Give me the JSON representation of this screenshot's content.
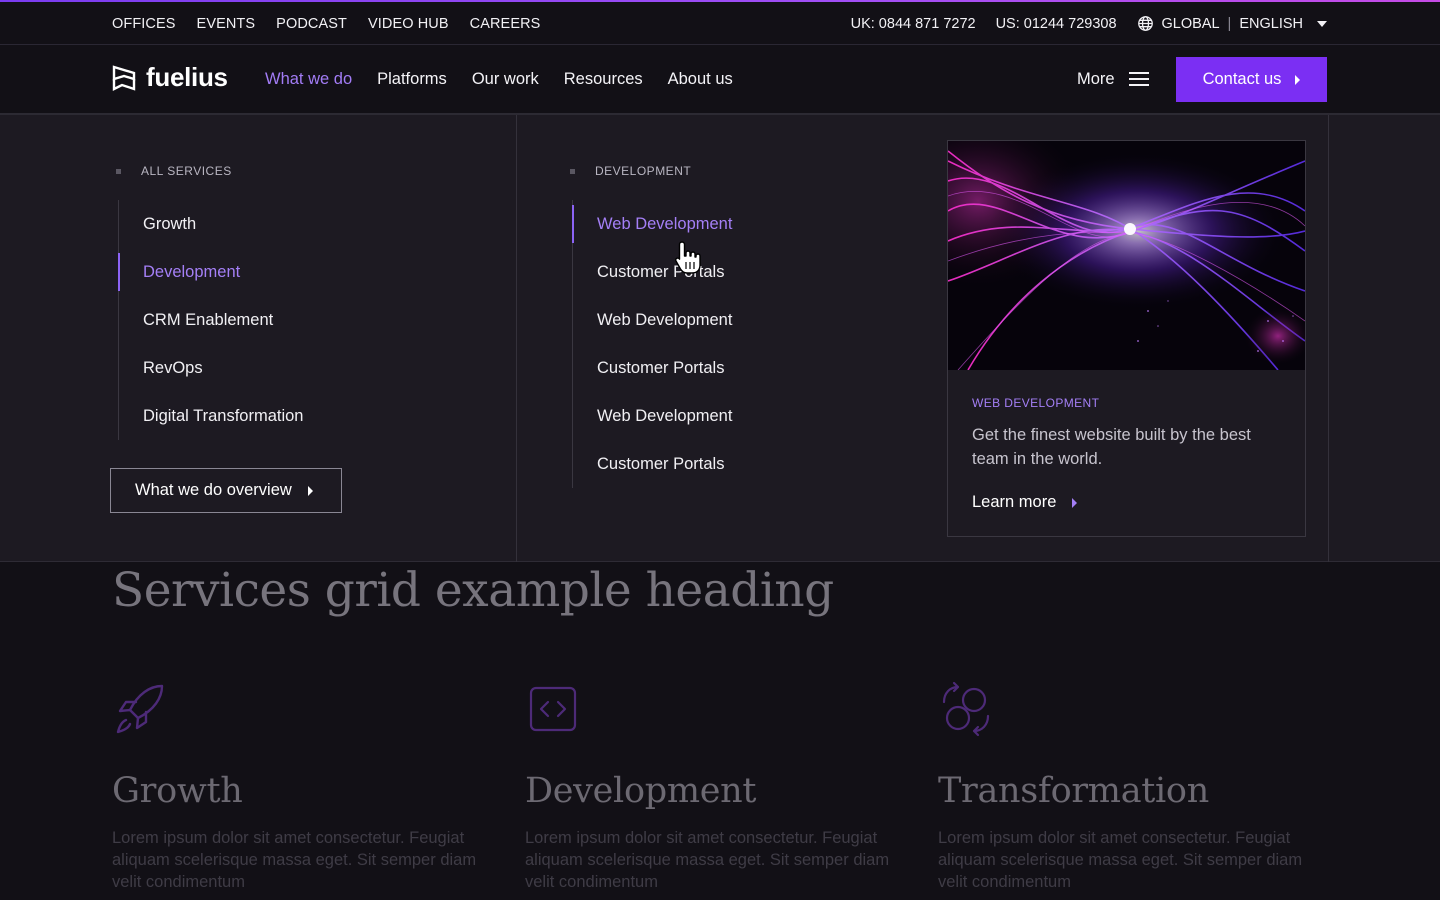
{
  "utility": {
    "links": [
      "OFFICES",
      "EVENTS",
      "PODCAST",
      "VIDEO HUB",
      "CAREERS"
    ],
    "phone_uk": "UK: 0844 871 7272",
    "phone_us": "US: 01244 729308",
    "region": "GLOBAL",
    "language": "ENGLISH"
  },
  "header": {
    "logo_text": "fuelius",
    "nav": [
      "What we do",
      "Platforms",
      "Our work",
      "Resources",
      "About us"
    ],
    "active_nav": "What we do",
    "more_label": "More",
    "contact_label": "Contact us"
  },
  "mega": {
    "services": {
      "eyebrow": "ALL SERVICES",
      "items": [
        "Growth",
        "Development",
        "CRM Enablement",
        "RevOps",
        "Digital Transformation"
      ],
      "active": "Development",
      "overview_label": "What we do overview"
    },
    "development": {
      "eyebrow": "DEVELOPMENT",
      "items": [
        "Web Development",
        "Customer Portals",
        "Web Development",
        "Customer Portals",
        "Web Development",
        "Customer Portals"
      ],
      "active_index": 0
    },
    "feature": {
      "eyebrow": "WEB DEVELOPMENT",
      "description": "Get the finest website built by the best team in the world.",
      "cta": "Learn more"
    }
  },
  "page": {
    "heading": "Services grid example heading",
    "services": [
      {
        "title": "Growth",
        "body": "Lorem ipsum dolor sit amet consectetur. Feugiat aliquam scelerisque massa eget. Sit semper diam velit condimentum",
        "icon": "rocket-icon"
      },
      {
        "title": "Development",
        "body": "Lorem ipsum dolor sit amet consectetur. Feugiat aliquam scelerisque massa eget. Sit semper diam velit condimentum",
        "icon": "code-icon"
      },
      {
        "title": "Transformation",
        "body": "Lorem ipsum dolor sit amet consectetur. Feugiat aliquam scelerisque massa eget. Sit semper diam velit condimentum",
        "icon": "transform-icon"
      }
    ]
  },
  "colors": {
    "accent": "#7b2ff3",
    "accent_text": "#a47ff6",
    "background": "#121016",
    "menu_bg": "#1d1a22"
  }
}
